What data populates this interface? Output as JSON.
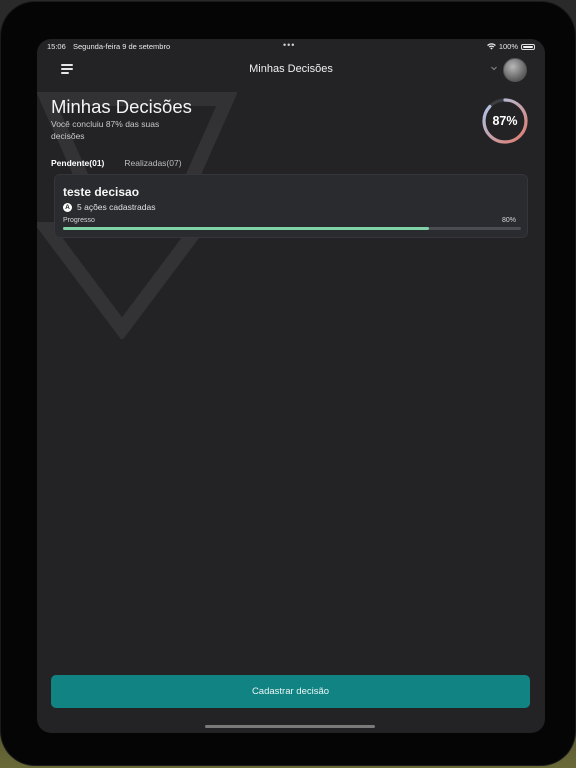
{
  "status_bar": {
    "time": "15:06",
    "date": "Segunda-feira 9 de setembro",
    "dots": "•••",
    "battery": "100%"
  },
  "navbar": {
    "title": "Minhas Decisões"
  },
  "header": {
    "title": "Minhas Decisões",
    "subtitle": "Você concluiu 87% das suas decisões",
    "completion_percent": 87,
    "completion_label": "87%"
  },
  "tabs": [
    {
      "label": "Pendente(01)",
      "active": true
    },
    {
      "label": "Realizadas(07)",
      "active": false
    }
  ],
  "decisions": [
    {
      "title": "teste decisao",
      "actions_icon_letter": "A",
      "actions_text": "5 ações cadastradas",
      "progress_label": "Progresso",
      "progress_value_label": "80%",
      "progress_percent": 80
    }
  ],
  "primary_button": {
    "label": "Cadastrar decisão"
  },
  "colors": {
    "accent_teal": "#128383",
    "progress_green": "#7fd3a7",
    "ring_gradient_start": "#e07a6a",
    "ring_gradient_end": "#a9c9ef",
    "background": "#232325"
  },
  "icons": {
    "menu": "hamburger-menu-icon",
    "chevron": "chevron-down-icon",
    "wifi": "wifi-icon",
    "battery": "battery-icon"
  }
}
